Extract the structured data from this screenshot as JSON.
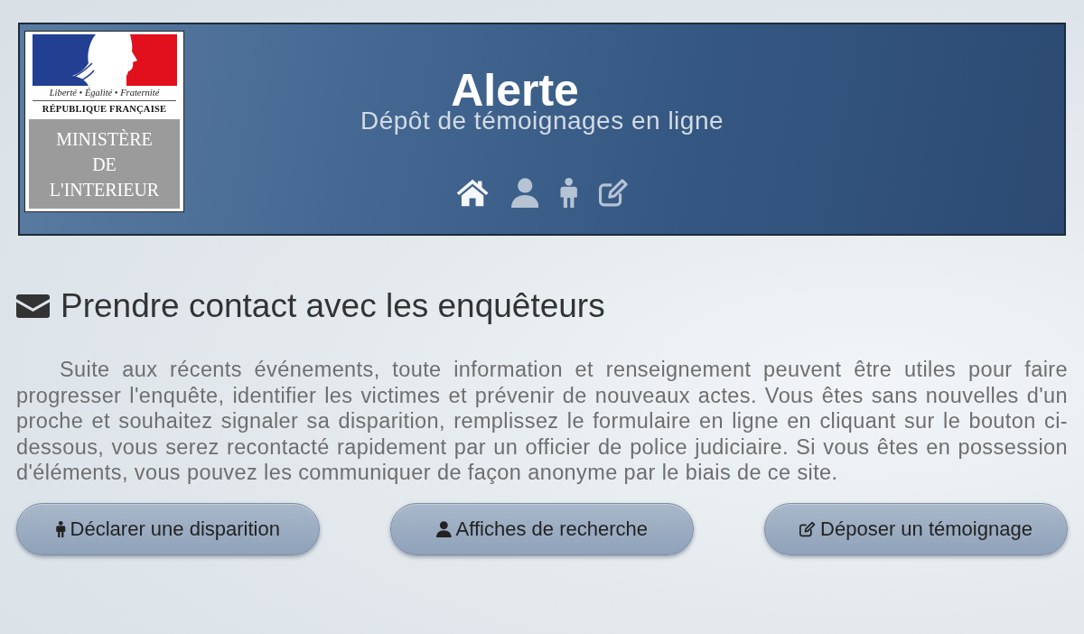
{
  "logo": {
    "motto": "Liberté • Égalité • Fraternité",
    "republic": "RÉPUBLIQUE FRANÇAISE",
    "ministry_lines": [
      "MINISTÈRE",
      "DE",
      "L'INTERIEUR"
    ]
  },
  "header": {
    "title": "Alerte",
    "subtitle": "Dépôt de témoignages en ligne",
    "nav": [
      {
        "kind": "home",
        "selected": true
      },
      {
        "kind": "user",
        "selected": false
      },
      {
        "kind": "person",
        "selected": false
      },
      {
        "kind": "edit",
        "selected": false
      }
    ]
  },
  "section": {
    "heading": "Prendre contact avec les enquêteurs",
    "paragraph": "Suite aux récents événements, toute information et renseignement peuvent être utiles pour faire progresser l'enquête, identifier les victimes et prévenir de nouveaux actes. Vous êtes sans nouvelles d'un proche et souhaitez signaler sa disparition, remplissez le formulaire en ligne en cliquant sur le bouton ci-dessous, vous serez recontacté rapidement par un officier de police judiciaire. Si vous êtes en possession d'éléments, vous pouvez les communiquer de façon anonyme par le biais de ce site."
  },
  "buttons": [
    {
      "kind": "person",
      "label": "Déclarer une disparition"
    },
    {
      "kind": "user",
      "label": "Affiches de recherche"
    },
    {
      "kind": "edit",
      "label": "Déposer un témoignage"
    }
  ]
}
